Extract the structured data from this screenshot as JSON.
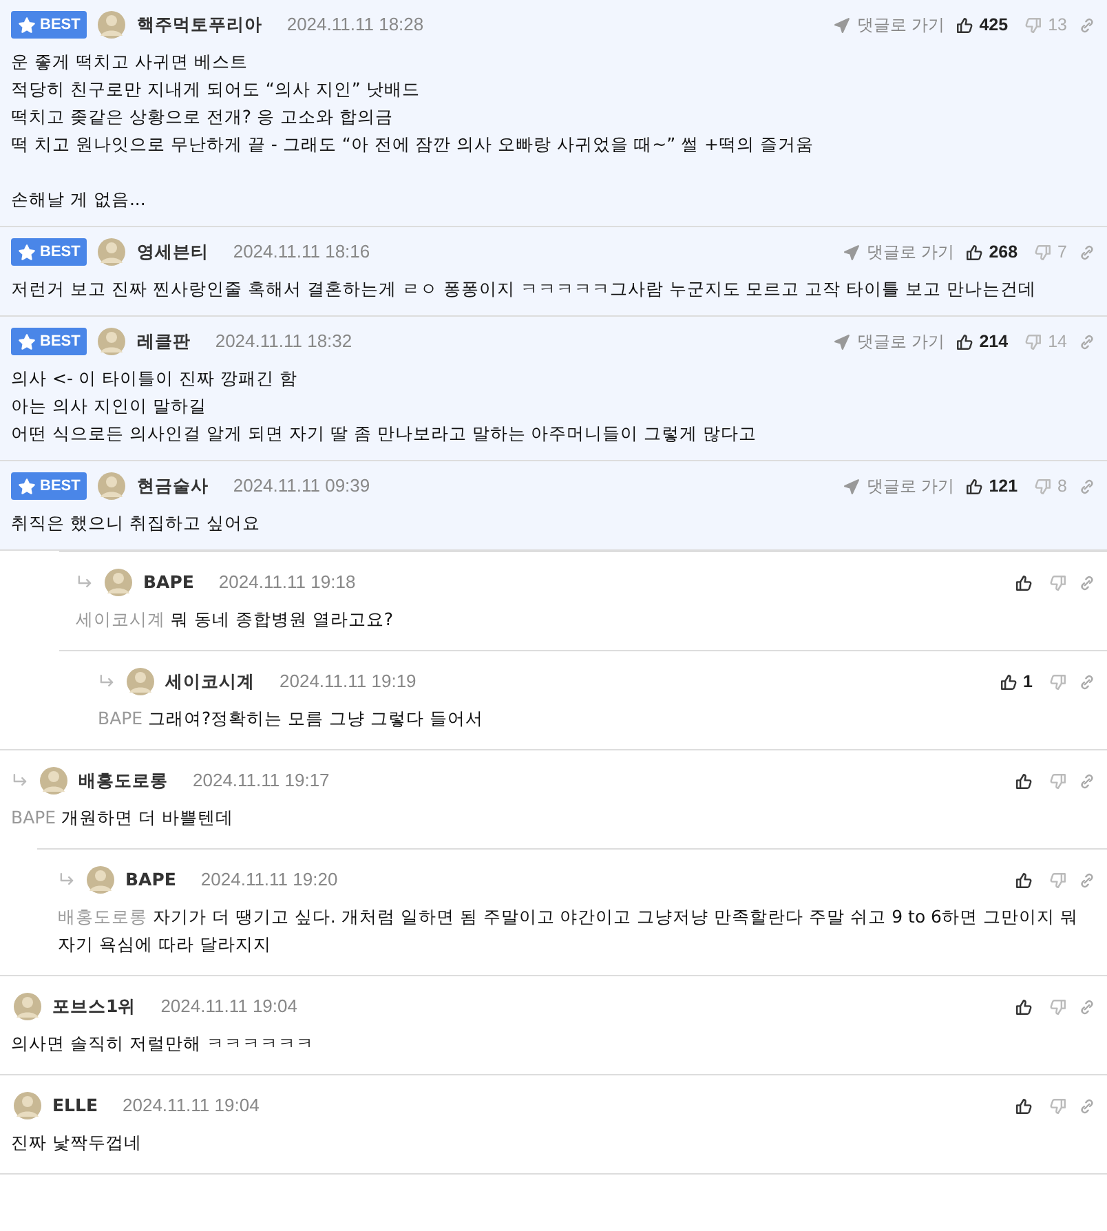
{
  "comments": [
    {
      "kind": "best",
      "badge": "BEST",
      "author": "핵주먹토푸리아",
      "date": "2024.11.11 18:28",
      "goto": "댓글로 가기",
      "likes": "425",
      "dislikes": "13",
      "body": "운 좋게 떡치고 사귀면 베스트\n적당히 친구로만 지내게 되어도 “의사 지인” 낫배드\n떡치고 좆같은 상황으로 전개? 응 고소와 합의금\n떡 치고 원나잇으로 무난하게 끝 - 그래도 “아 전에 잠깐 의사 오빠랑 사귀었을 때~” 썰 +떡의 즐거움\n\n손해날 게 없음..."
    },
    {
      "kind": "best",
      "badge": "BEST",
      "author": "영세븐티",
      "date": "2024.11.11 18:16",
      "goto": "댓글로 가기",
      "likes": "268",
      "dislikes": "7",
      "body": "저런거 보고 진짜 찐사랑인줄 혹해서 결혼하는게 ㄹㅇ 퐁퐁이지 ㅋㅋㅋㅋㅋ그사람 누군지도 모르고 고작 타이틀 보고 만나는건데"
    },
    {
      "kind": "best",
      "badge": "BEST",
      "author": "레클판",
      "date": "2024.11.11 18:32",
      "goto": "댓글로 가기",
      "likes": "214",
      "dislikes": "14",
      "body": "의사 <- 이 타이틀이 진짜 깡패긴 함\n아는 의사 지인이 말하길\n어떤 식으로든 의사인걸 알게 되면 자기 딸 좀 만나보라고 말하는 아주머니들이 그렇게 많다고"
    },
    {
      "kind": "best",
      "badge": "BEST",
      "author": "현금술사",
      "date": "2024.11.11 09:39",
      "goto": "댓글로 가기",
      "likes": "121",
      "dislikes": "8",
      "body": "취직은 했으니 취집하고 싶어요"
    },
    {
      "kind": "thread",
      "children": [
        {
          "kind": "thread",
          "children": [
            {
              "kind": "reply",
              "author": "BAPE",
              "date": "2024.11.11 19:18",
              "mention": "세이코시계",
              "body": "뭐 동네 종합병원 열라고요?",
              "children": [
                {
                  "kind": "reply",
                  "author": "세이코시계",
                  "date": "2024.11.11 19:19",
                  "likes": "1",
                  "mention": "BAPE",
                  "body": "그래여?정확히는 모름 그냥 그렇다 들어서"
                }
              ]
            }
          ]
        },
        {
          "kind": "reply",
          "author": "배홍도로롱",
          "date": "2024.11.11 19:17",
          "mention": "BAPE",
          "body": "개원하면 더 바쁠텐데",
          "children": [
            {
              "kind": "reply",
              "author": "BAPE",
              "date": "2024.11.11 19:20",
              "mention": "배홍도로롱",
              "body": "자기가 더 땡기고 싶다. 개처럼 일하면 됨 주말이고 야간이고 그냥저냥 만족할란다 주말 쉬고 9 to 6하면 그만이지 뭐 자기 욕심에 따라 달라지지"
            }
          ]
        }
      ]
    },
    {
      "kind": "normal",
      "author": "포브스1위",
      "date": "2024.11.11 19:04",
      "body": "의사면 솔직히 저럴만해 ㅋㅋㅋㅋㅋㅋ"
    },
    {
      "kind": "normal",
      "author": "ELLE",
      "date": "2024.11.11 19:04",
      "body": "진짜 낯짝두껍네"
    }
  ]
}
